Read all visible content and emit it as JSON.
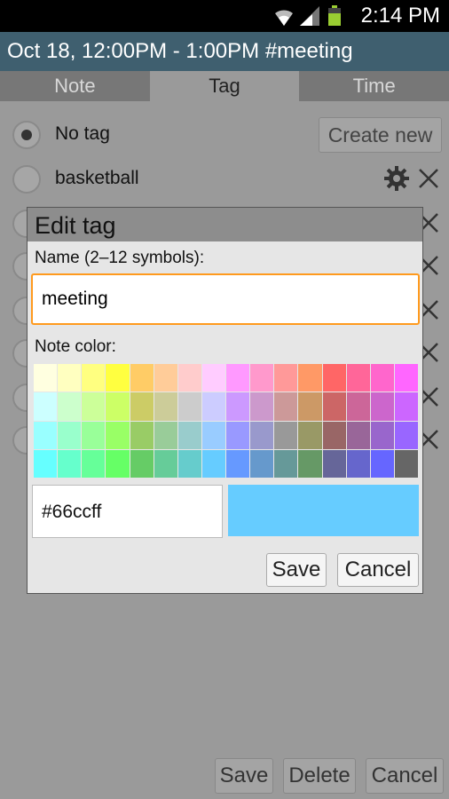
{
  "status": {
    "time": "2:14 PM"
  },
  "header": {
    "title": "Oct 18, 12:00PM - 1:00PM",
    "tag": "#meeting"
  },
  "tabs": [
    {
      "label": "Note"
    },
    {
      "label": "Tag"
    },
    {
      "label": "Time"
    }
  ],
  "tag_list": {
    "create_new_label": "Create new",
    "items": [
      {
        "label": "No tag",
        "selected": true
      },
      {
        "label": "basketball",
        "selected": false
      }
    ]
  },
  "dialog": {
    "title": "Edit tag",
    "name_label": "Name (2–12 symbols):",
    "name_value": "meeting",
    "color_label": "Note color:",
    "hex_value": "#66ccff",
    "selected_color": "#66ccff",
    "palette": [
      "#ffffe0",
      "#ffffc0",
      "#ffff80",
      "#ffff40",
      "#ffcc66",
      "#ffcc99",
      "#ffcccc",
      "#ffccff",
      "#ff99ff",
      "#ff99cc",
      "#ff9999",
      "#ff9966",
      "#ff6666",
      "#ff6699",
      "#ff66cc",
      "#ff66ff",
      "#ccffff",
      "#ccffcc",
      "#ccff99",
      "#ccff66",
      "#cccc66",
      "#cccc99",
      "#cccccc",
      "#ccccff",
      "#cc99ff",
      "#cc99cc",
      "#cc9999",
      "#cc9966",
      "#cc6666",
      "#cc6699",
      "#cc66cc",
      "#cc66ff",
      "#99ffff",
      "#99ffcc",
      "#99ff99",
      "#99ff66",
      "#99cc66",
      "#99cc99",
      "#99cccc",
      "#99ccff",
      "#9999ff",
      "#9999cc",
      "#999999",
      "#999966",
      "#996666",
      "#996699",
      "#9966cc",
      "#9966ff",
      "#66ffff",
      "#66ffcc",
      "#66ff99",
      "#66ff66",
      "#66cc66",
      "#66cc99",
      "#66cccc",
      "#66ccff",
      "#6699ff",
      "#6699cc",
      "#669999",
      "#669966",
      "#666699",
      "#6666cc",
      "#6666ff",
      "#666666"
    ],
    "save_label": "Save",
    "cancel_label": "Cancel"
  },
  "bottom": {
    "save_label": "Save",
    "delete_label": "Delete",
    "cancel_label": "Cancel"
  }
}
